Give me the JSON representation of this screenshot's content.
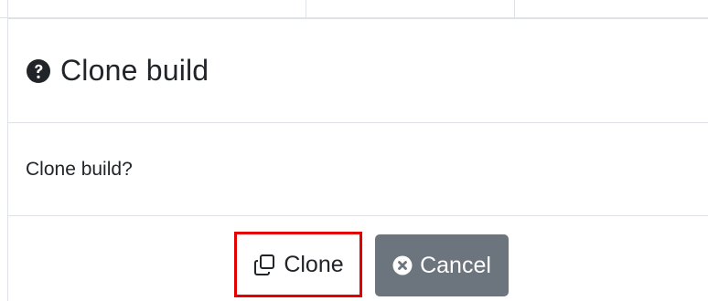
{
  "dialog": {
    "title": "Clone build",
    "title_icon": "question-circle-icon",
    "body_text": "Clone build?",
    "buttons": {
      "clone": {
        "label": "Clone",
        "icon": "clone-icon",
        "highlight_color": "#e50000"
      },
      "cancel": {
        "label": "Cancel",
        "icon": "times-circle-icon",
        "color": "#6c757d"
      }
    }
  }
}
